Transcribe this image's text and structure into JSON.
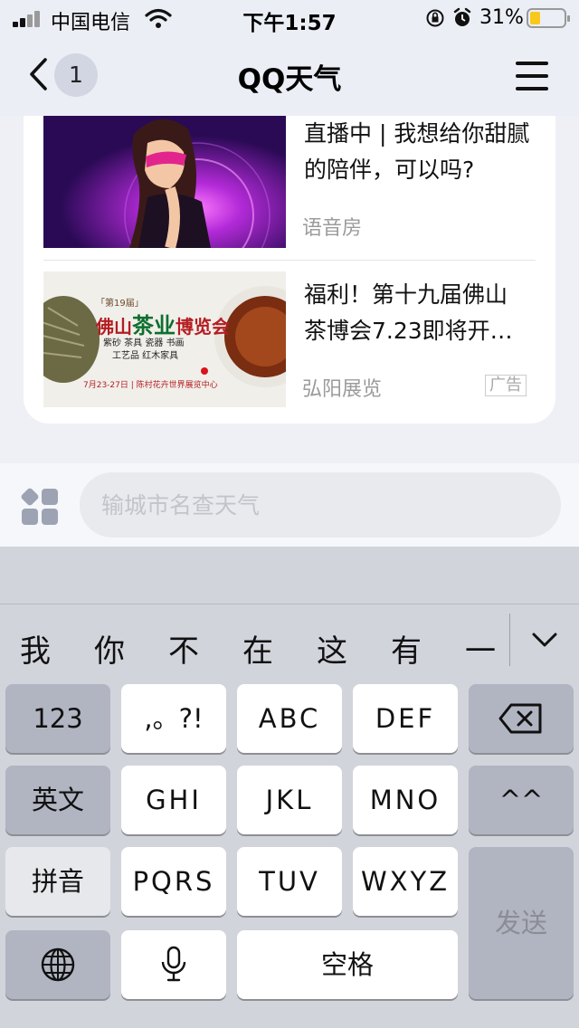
{
  "status_bar": {
    "carrier": "中国电信",
    "time": "下午1:57",
    "battery_percent": "31%",
    "battery_level": 0.31,
    "battery_color": "#f8c81c",
    "icons": [
      "signal-icon",
      "wifi-icon",
      "orientation-lock-icon",
      "alarm-icon",
      "battery-icon"
    ]
  },
  "nav": {
    "back_icon": "chevron-left-icon",
    "unread_count": "1",
    "title": "QQ天气",
    "menu_icon": "hamburger-menu-icon"
  },
  "feed": {
    "items": [
      {
        "headline": "直播中 | 我想给你甜腻的陪伴，可以吗?",
        "source": "语音房",
        "thumbnail": "masked-woman-illustration"
      },
      {
        "headline": "福利！第十九届佛山茶博会7.23即将开…",
        "source": "弘阳展览",
        "ad_label": "广告",
        "thumbnail": "tea-expo-banner",
        "banner": {
          "edition": "「第19届」",
          "title_a": "佛山",
          "title_b": "茶业",
          "title_c": "博览会",
          "line1": "紫砂 茶具 瓷器 书画",
          "line2": "工艺品 红木家具",
          "date": "7月23-27日 | 陈村花卉世界展览中心"
        }
      }
    ]
  },
  "input_bar": {
    "apps_icon": "app-grid-icon",
    "placeholder": "输城市名查天气"
  },
  "keyboard": {
    "candidates": [
      "我",
      "你",
      "不",
      "在",
      "这",
      "有",
      "一"
    ],
    "collapse_icon": "chevron-down-icon",
    "keys": {
      "num": "123",
      "punct": ",。?!",
      "abc": "ABC",
      "def": "DEF",
      "delete_icon": "backspace-icon",
      "eng": "英文",
      "ghi": "GHI",
      "jkl": "JKL",
      "mno": "MNO",
      "emoticon": "^^",
      "pinyin": "拼音",
      "pqrs": "PQRS",
      "tuv": "TUV",
      "wxyz": "WXYZ",
      "send": "发送",
      "globe_icon": "globe-icon",
      "mic_icon": "microphone-icon",
      "space": "空格"
    }
  }
}
